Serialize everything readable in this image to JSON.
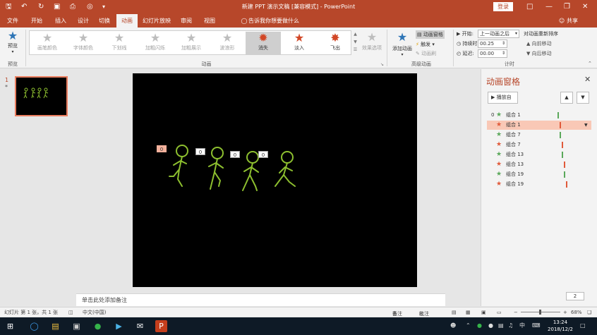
{
  "window": {
    "title": "新建 PPT 演示文稿 [兼容模式] - PowerPoint",
    "login_label": "登录",
    "share_label": "共享"
  },
  "tabs": [
    "文件",
    "开始",
    "插入",
    "设计",
    "切换",
    "动画",
    "幻灯片放映",
    "审阅",
    "视图"
  ],
  "active_tab": "动画",
  "tell_me": "告诉我你想要做什么",
  "ribbon": {
    "preview": {
      "label": "预览",
      "group": "预览"
    },
    "animation_group": "动画",
    "effects": [
      {
        "label": "画笔颜色",
        "state": "disabled"
      },
      {
        "label": "字体颜色",
        "state": "disabled"
      },
      {
        "label": "下划线",
        "state": "disabled"
      },
      {
        "label": "加粗闪烁",
        "state": "disabled"
      },
      {
        "label": "加粗展示",
        "state": "disabled"
      },
      {
        "label": "波浪形",
        "state": "disabled"
      },
      {
        "label": "消失",
        "state": "selected"
      },
      {
        "label": "淡入",
        "state": "enabled"
      },
      {
        "label": "飞出",
        "state": "enabled"
      }
    ],
    "effect_options": "效果选项",
    "advanced": {
      "group": "高级动画",
      "add_animation": "添加动画",
      "pane": "动画窗格",
      "trigger": "触发",
      "painter": "动画刷"
    },
    "timing": {
      "group": "计时",
      "start_label": "开始:",
      "start_value": "上一动画之后",
      "duration_label": "持续时间:",
      "duration_value": "00.25",
      "delay_label": "延迟:",
      "delay_value": "00.00",
      "reorder_title": "对动画重新排序",
      "move_earlier": "向前移动",
      "move_later": "向后移动"
    }
  },
  "thumbnail": {
    "number": "1",
    "star": "*"
  },
  "slide_tags": [
    "0",
    "0",
    "0",
    "0"
  ],
  "notes_placeholder": "单击此处添加备注",
  "animation_pane": {
    "title": "动画窗格",
    "play_from": "播放自",
    "items": [
      {
        "num": "0",
        "name": "组合 1",
        "effect": "entrance",
        "selected": false
      },
      {
        "num": "",
        "name": "组合 1",
        "effect": "exit",
        "selected": true
      },
      {
        "num": "",
        "name": "组合 7",
        "effect": "entrance",
        "selected": false
      },
      {
        "num": "",
        "name": "组合 7",
        "effect": "exit",
        "selected": false
      },
      {
        "num": "",
        "name": "组合 13",
        "effect": "entrance",
        "selected": false
      },
      {
        "num": "",
        "name": "组合 13",
        "effect": "exit",
        "selected": false
      },
      {
        "num": "",
        "name": "组合 19",
        "effect": "entrance",
        "selected": false
      },
      {
        "num": "",
        "name": "组合 19",
        "effect": "exit",
        "selected": false
      }
    ],
    "page_box": "2"
  },
  "statusbar": {
    "slide_info": "幻灯片 第 1 张，共 1 张",
    "language": "中文(中国)",
    "notes": "备注",
    "comments": "批注",
    "zoom": "68%"
  },
  "taskbar": {
    "time": "13:24",
    "date": "2018/12/2",
    "ime": "中"
  },
  "colors": {
    "accent": "#b7472a",
    "entrance": "#5aa85a",
    "exit": "#e05a3a",
    "figure": "#8dbf2f"
  }
}
